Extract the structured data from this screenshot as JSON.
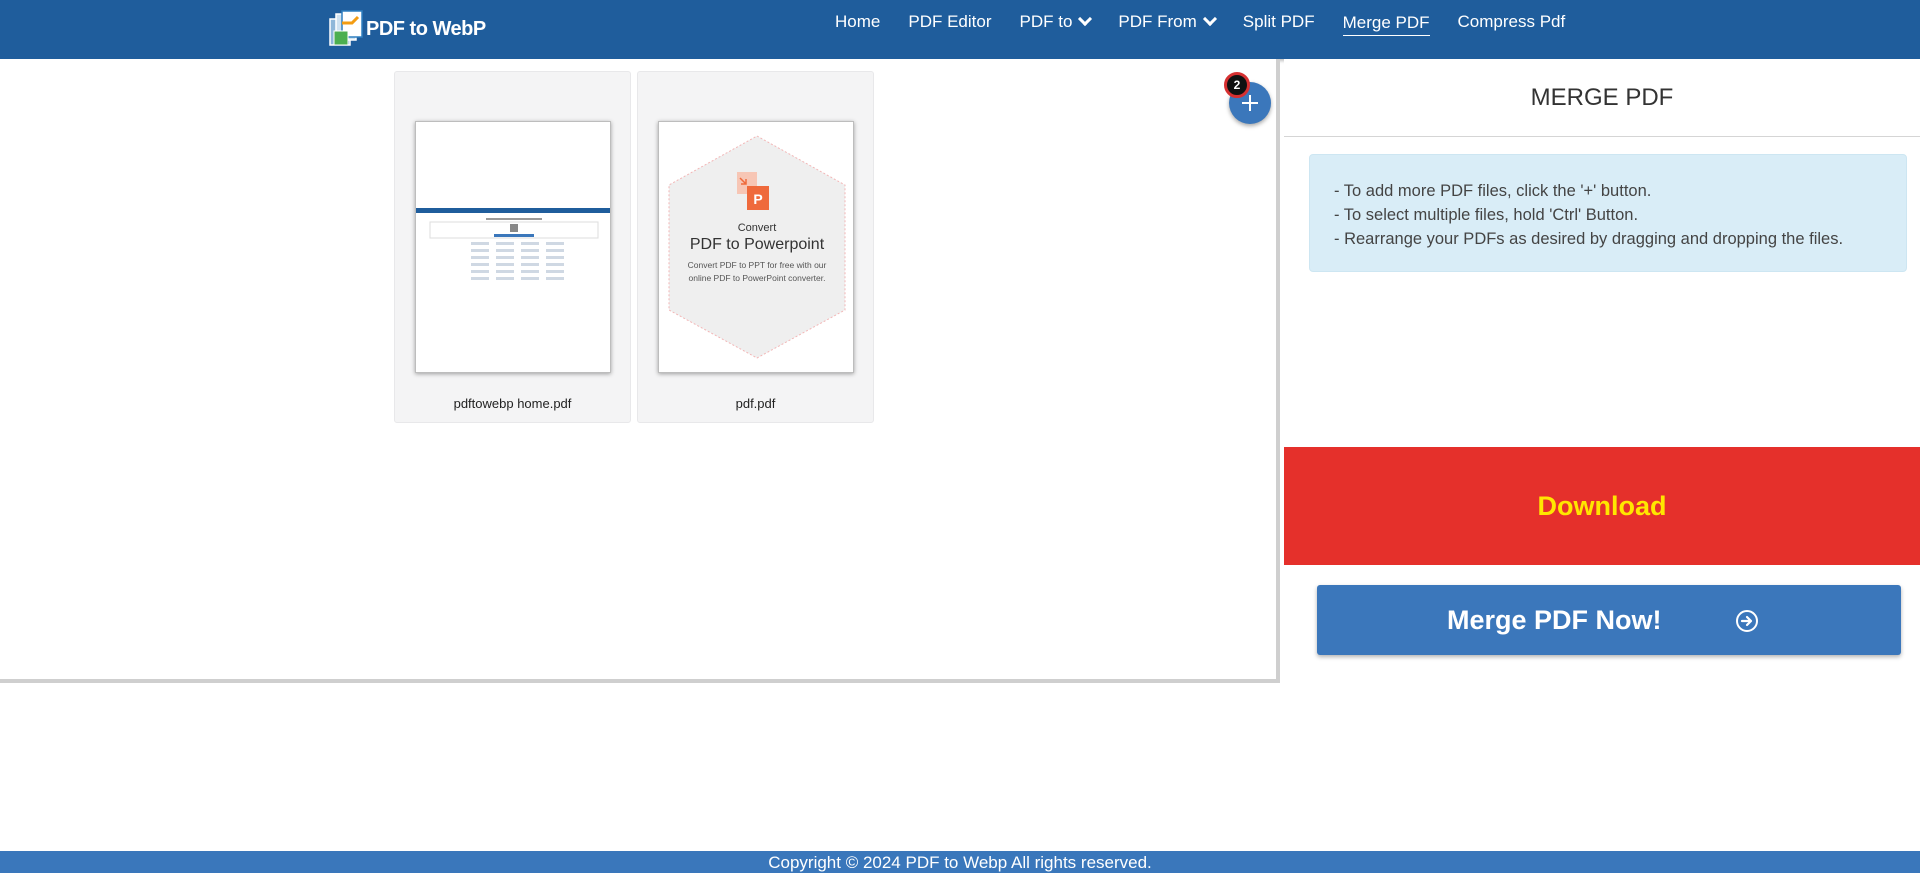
{
  "brand": {
    "name": "PDF to WebP"
  },
  "nav": {
    "items": [
      {
        "label": "Home"
      },
      {
        "label": "PDF Editor"
      },
      {
        "label": "PDF to"
      },
      {
        "label": "PDF From"
      },
      {
        "label": "Split PDF"
      },
      {
        "label": "Merge PDF"
      },
      {
        "label": "Compress Pdf"
      }
    ]
  },
  "workspace": {
    "file_count": "2",
    "files": [
      {
        "name": "pdftowebp home.pdf"
      },
      {
        "name": "pdf.pdf",
        "preview": {
          "line1": "Convert",
          "line2": "PDF to Powerpoint",
          "line3": "Convert PDF to PPT for free with our",
          "line4": "online PDF to PowerPoint converter."
        }
      }
    ]
  },
  "panel": {
    "title": "MERGE PDF",
    "instructions": [
      "- To add more PDF files, click the '+' button.",
      "- To select multiple files, hold 'Ctrl' Button.",
      "- Rearrange your PDFs as desired by dragging and dropping the files."
    ],
    "download_label": "Download",
    "merge_label": "Merge PDF Now!"
  },
  "footer": {
    "text": "Copyright © 2024 PDF to Webp All rights reserved."
  },
  "colors": {
    "header": "#1f5d9c",
    "accent": "#3b77bb",
    "download_bg": "#e5302b",
    "download_text": "#ffe600",
    "info_bg": "#d9edf7"
  }
}
